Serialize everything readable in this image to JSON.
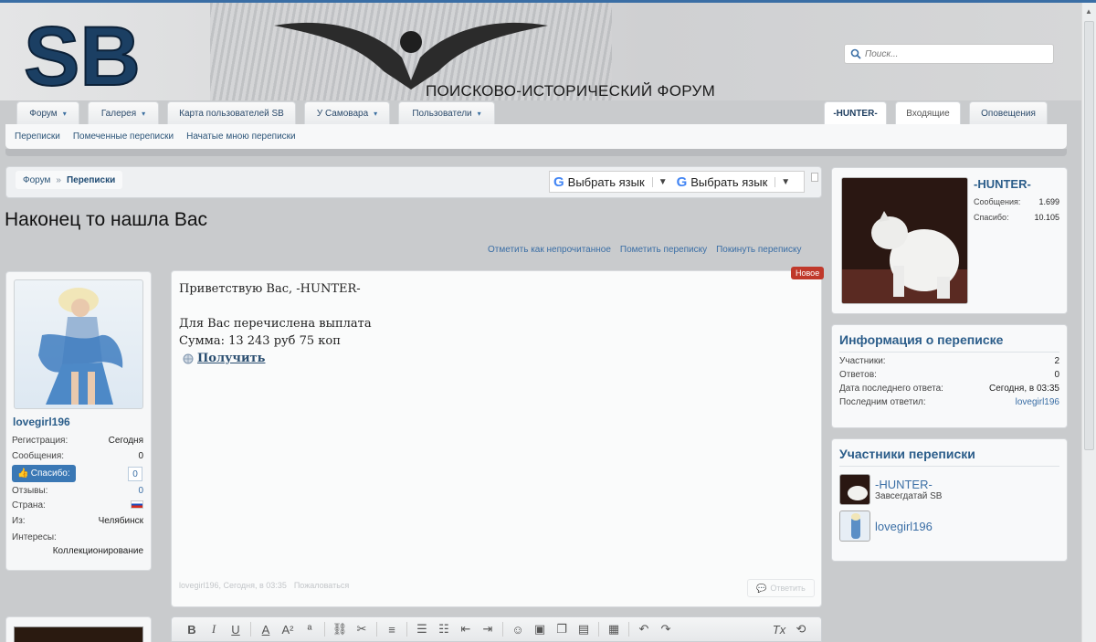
{
  "header": {
    "slogan": "ПОИСКОВО-ИСТОРИЧЕСКИЙ ФОРУМ",
    "search_placeholder": "Поиск..."
  },
  "nav": {
    "tabs": [
      {
        "label": "Форум",
        "caret": "▾"
      },
      {
        "label": "Галерея",
        "caret": "▾"
      },
      {
        "label": "Карта пользователей SB"
      },
      {
        "label": "У Самовара",
        "caret": "▾"
      },
      {
        "label": "Пользователи",
        "caret": "▾"
      }
    ],
    "right_tabs": [
      {
        "label": "-HUNTER-"
      },
      {
        "label": "Входящие"
      },
      {
        "label": "Оповещения"
      }
    ],
    "subnav": [
      "Переписки",
      "Помеченные переписки",
      "Начатые мною переписки"
    ]
  },
  "breadcrumb": {
    "home": "Форум",
    "separator": "»",
    "current": "Переписки"
  },
  "translate": {
    "label1": "Выбрать язык",
    "label2": "Выбрать язык",
    "arrow": "▼",
    "g": "G"
  },
  "page": {
    "title": "Наконец то нашла Вас",
    "actions": [
      "Отметить как непрочитанное",
      "Пометить переписку",
      "Покинуть переписку"
    ]
  },
  "sender": {
    "name": "lovegirl196",
    "rows": [
      {
        "label": "Регистрация:",
        "value": "Сегодня"
      },
      {
        "label": "Сообщения:",
        "value": "0"
      },
      {
        "label": "Отзывы:",
        "value": "0"
      },
      {
        "label": "Страна:",
        "value": ""
      },
      {
        "label": "Из:",
        "value": "Челябинск"
      },
      {
        "label": "Интересы:",
        "value": ""
      }
    ],
    "interests": "Коллекционирование",
    "thanks_label": "Спасибо:",
    "thanks_count": "0"
  },
  "message": {
    "badge": "Новое",
    "greeting": "Приветствую Вас, -HUNTER-",
    "line1": "Для Вас перечислена выплата",
    "line2": "Сумма: 13 243 руб 75 коп",
    "link": "Получить",
    "footer_meta": "lovegirl196, Сегодня, в 03:35",
    "report": "Пожаловаться",
    "reply": "Ответить"
  },
  "profile": {
    "name": "-HUNTER-",
    "rows": [
      {
        "label": "Сообщения:",
        "value": "1.699"
      },
      {
        "label": "Спасибо:",
        "value": "10.105"
      }
    ]
  },
  "conv_info": {
    "title": "Информация о переписке",
    "rows": [
      {
        "label": "Участники:",
        "value": "2"
      },
      {
        "label": "Ответов:",
        "value": "0"
      },
      {
        "label": "Дата последнего ответа:",
        "value": "Сегодня, в 03:35"
      },
      {
        "label": "Последним ответил:",
        "value": "lovegirl196"
      }
    ]
  },
  "participants": {
    "title": "Участники переписки",
    "items": [
      {
        "name": "-HUNTER-",
        "title": "Завсегдатай SB"
      },
      {
        "name": "lovegirl196",
        "title": ""
      }
    ]
  },
  "colors": {
    "accent": "#3a6ea5",
    "badge": "#c0392b",
    "link": "#2a5d8a"
  }
}
